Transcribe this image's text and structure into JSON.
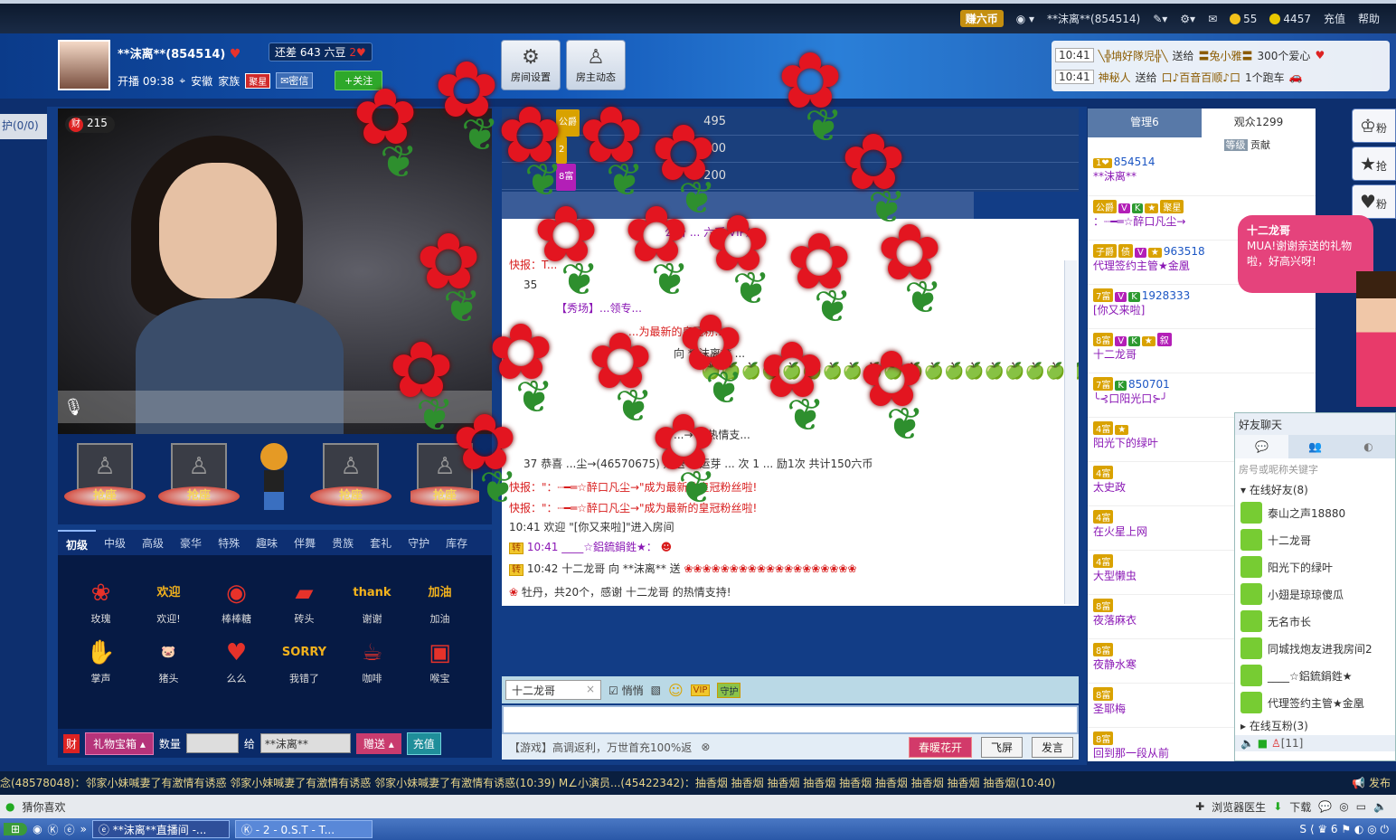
{
  "topbar": {
    "task_label": "赚六币",
    "user": "**沫离**(854514)",
    "coins": "55",
    "lemons": "4457",
    "recharge": "充值",
    "help": "帮助"
  },
  "header": {
    "anchor_name": "**沫离**(854514)",
    "gap_text": "还差 643 六豆",
    "gap_heart": "2",
    "start_time": "开播 09:38",
    "location": "安徽",
    "family_label": "家族",
    "family_tag": "聚星",
    "msg_label": "密信",
    "follow_label": "+关注",
    "btn_room_settings": "房间设置",
    "btn_host_activity": "房主动态",
    "ticker": [
      {
        "time": "10:41",
        "from": "╲╬㘱好隊児╬╲",
        "action": "送给",
        "to": "〓兔小雅〓",
        "gift": "300个爱心"
      },
      {
        "time": "10:41",
        "from": "神秘人",
        "action": "送给",
        "to": "口♪百音百顺♪口",
        "gift": "1个跑车"
      }
    ]
  },
  "left": {
    "guard_label": "护(0/0)",
    "cai_count": "215",
    "seat_label": "抢座",
    "gift_tabs": [
      "初级",
      "中级",
      "高级",
      "豪华",
      "特殊",
      "趣味",
      "伴舞",
      "贵族",
      "套礼",
      "守护",
      "库存"
    ],
    "gifts": [
      {
        "name": "玫瑰",
        "icon": "rose-gift-icon",
        "glyph": "❀"
      },
      {
        "name": "欢迎!",
        "icon": "welcome-gift-icon",
        "glyph": "欢迎"
      },
      {
        "name": "棒棒糖",
        "icon": "lollipop-gift-icon",
        "glyph": "◉"
      },
      {
        "name": "砖头",
        "icon": "brick-gift-icon",
        "glyph": "▰"
      },
      {
        "name": "谢谢",
        "icon": "thanks-gift-icon",
        "glyph": "thank"
      },
      {
        "name": "加油",
        "icon": "cheer-gift-icon",
        "glyph": "加油"
      },
      {
        "name": "掌声",
        "icon": "applause-gift-icon",
        "glyph": "✋"
      },
      {
        "name": "猪头",
        "icon": "pig-gift-icon",
        "glyph": "🐷"
      },
      {
        "name": "么么",
        "icon": "kiss-gift-icon",
        "glyph": "♥"
      },
      {
        "name": "我错了",
        "icon": "sorry-gift-icon",
        "glyph": "SORRY"
      },
      {
        "name": "咖啡",
        "icon": "coffee-gift-icon",
        "glyph": "☕"
      },
      {
        "name": "喉宝",
        "icon": "lozenge-gift-icon",
        "glyph": "▣"
      }
    ],
    "gift_box": "礼物宝箱",
    "qty_label": "数量",
    "to_label": "给",
    "to_user": "**沫离**",
    "send_label": "赠送",
    "charge_label": "充值"
  },
  "rank": [
    {
      "tag": "公爵",
      "value": "495"
    },
    {
      "tag": "2",
      "value": "300"
    },
    {
      "tag": "8富",
      "value": "200"
    }
  ],
  "chat": {
    "lines": [
      {
        "prefix": "",
        "text": "公告 ... 六币 VIP》"
      },
      {
        "prefix": "",
        "text": "快报：T..."
      },
      {
        "prefix": "",
        "text": "35"
      },
      {
        "prefix": "",
        "text": "【秀场】...领专..."
      },
      {
        "prefix": "",
        "text": "...为最新的皇冠粉..."
      },
      {
        "prefix": "",
        "text": "向 **沫离** ..."
      },
      {
        "prefix": "",
        "text": "...→ 的热情支..."
      },
      {
        "prefix": "",
        "text": "37 恭喜 ...尘→(46570675) 赠送 幸运芽 ... 次 1 ... 励1次 共计150六币"
      },
      {
        "prefix": "",
        "text": "快报：\"：┈━═☆醉口凡尘→\"成为最新的皇冠粉丝啦!"
      },
      {
        "prefix": "",
        "text": "快报：\"：┈━═☆醉口凡尘→\"成为最新的皇冠粉丝啦!"
      },
      {
        "prefix": "",
        "text": "10:41 欢迎 \"[你又来啦]\"进入房间"
      },
      {
        "prefix": "转",
        "text": "10:41 ____☆鋁鋶鋗鉎★："
      },
      {
        "prefix": "转",
        "text": "10:42 十二龙哥 向 **沫离** 送"
      },
      {
        "prefix": "",
        "text": "牡丹，共20个，感谢 十二龙哥 的热情支持!"
      }
    ],
    "to_user": "十二龙哥",
    "whisper_label": "悄悄",
    "vip_label": "VIP",
    "guard_label": "守护",
    "game_ad": "【游戏】高调返利，万世首充100%返",
    "flower_btn": "春暖花开",
    "fly_btn": "飞屏",
    "speak_btn": "发言"
  },
  "right": {
    "tab_admin": "管理6",
    "tab_audience": "观众1299",
    "sub_level": "等级",
    "sub_contrib": "贡献",
    "users": [
      {
        "badges": [
          "1❤"
        ],
        "num": "854514",
        "name": "**沫离**"
      },
      {
        "badges": [
          "公爵",
          "V",
          "K",
          "★",
          "聚星"
        ],
        "num": "",
        "name": "：┈━═☆醉口凡尘→"
      },
      {
        "badges": [
          "子爵",
          "债",
          "V",
          "★"
        ],
        "num": "963518",
        "name": "代理签约主管★金凰"
      },
      {
        "badges": [
          "7富",
          "V",
          "K"
        ],
        "num": "1928333",
        "name": "[你又来啦]"
      },
      {
        "badges": [
          "8富",
          "V",
          "K",
          "★",
          "叙"
        ],
        "num": "",
        "name": "十二龙哥"
      },
      {
        "badges": [
          "7富",
          "K"
        ],
        "num": "850701",
        "name": "╰⊰口阳光口⊱╯"
      },
      {
        "badges": [
          "4富",
          "★"
        ],
        "num": "",
        "name": "阳光下的绿叶"
      },
      {
        "badges": [
          "4富"
        ],
        "num": "",
        "name": "太史政"
      },
      {
        "badges": [
          "4富"
        ],
        "num": "",
        "name": "在火星上网"
      },
      {
        "badges": [
          "4富"
        ],
        "num": "",
        "name": "大型懒虫"
      },
      {
        "badges": [
          "8富"
        ],
        "num": "",
        "name": "夜落麻衣"
      },
      {
        "badges": [
          "8富"
        ],
        "num": "",
        "name": "夜静水寒"
      },
      {
        "badges": [
          "8富"
        ],
        "num": "",
        "name": "圣耶梅"
      },
      {
        "badges": [
          "8富"
        ],
        "num": "",
        "name": "回到那一段从前"
      }
    ],
    "actions": [
      "粉",
      "抢",
      "粉"
    ]
  },
  "bubble": {
    "name": "十二龙哥",
    "text": "MUA!谢谢亲送的礼物啦，好高兴呀!"
  },
  "friends": {
    "title": "好友聊天",
    "search": "房号或昵称关键字",
    "online_group": "在线好友(8)",
    "items": [
      "泰山之声18880",
      "十二龙哥",
      "阳光下的绿叶",
      "小翅是琼琼傻瓜",
      "无名市长",
      "同城找炮友进我房间2",
      "____☆鋁鋶鋗鉎★",
      "代理签约主管★金凰"
    ],
    "mutual_group": "在线互粉(3)",
    "count": "[11]"
  },
  "marquee": "念(48578048)：邻家小妹喊妻了有激情有诱惑 邻家小妹喊妻了有激情有诱惑 邻家小妹喊妻了有激情有诱惑(10:39) M∠小演员...(45422342)：抽香烟 抽香烟 抽香烟 抽香烟 抽香烟 抽香烟 抽香烟 抽香烟 抽香烟(10:40)",
  "marquee_right": "发布",
  "status": {
    "left": "猜你喜欢",
    "doctor": "浏览器医生",
    "download": "下载"
  },
  "taskbar": [
    "**沫离**直播间 -...",
    "- 2 - 0.S.T - T..."
  ]
}
